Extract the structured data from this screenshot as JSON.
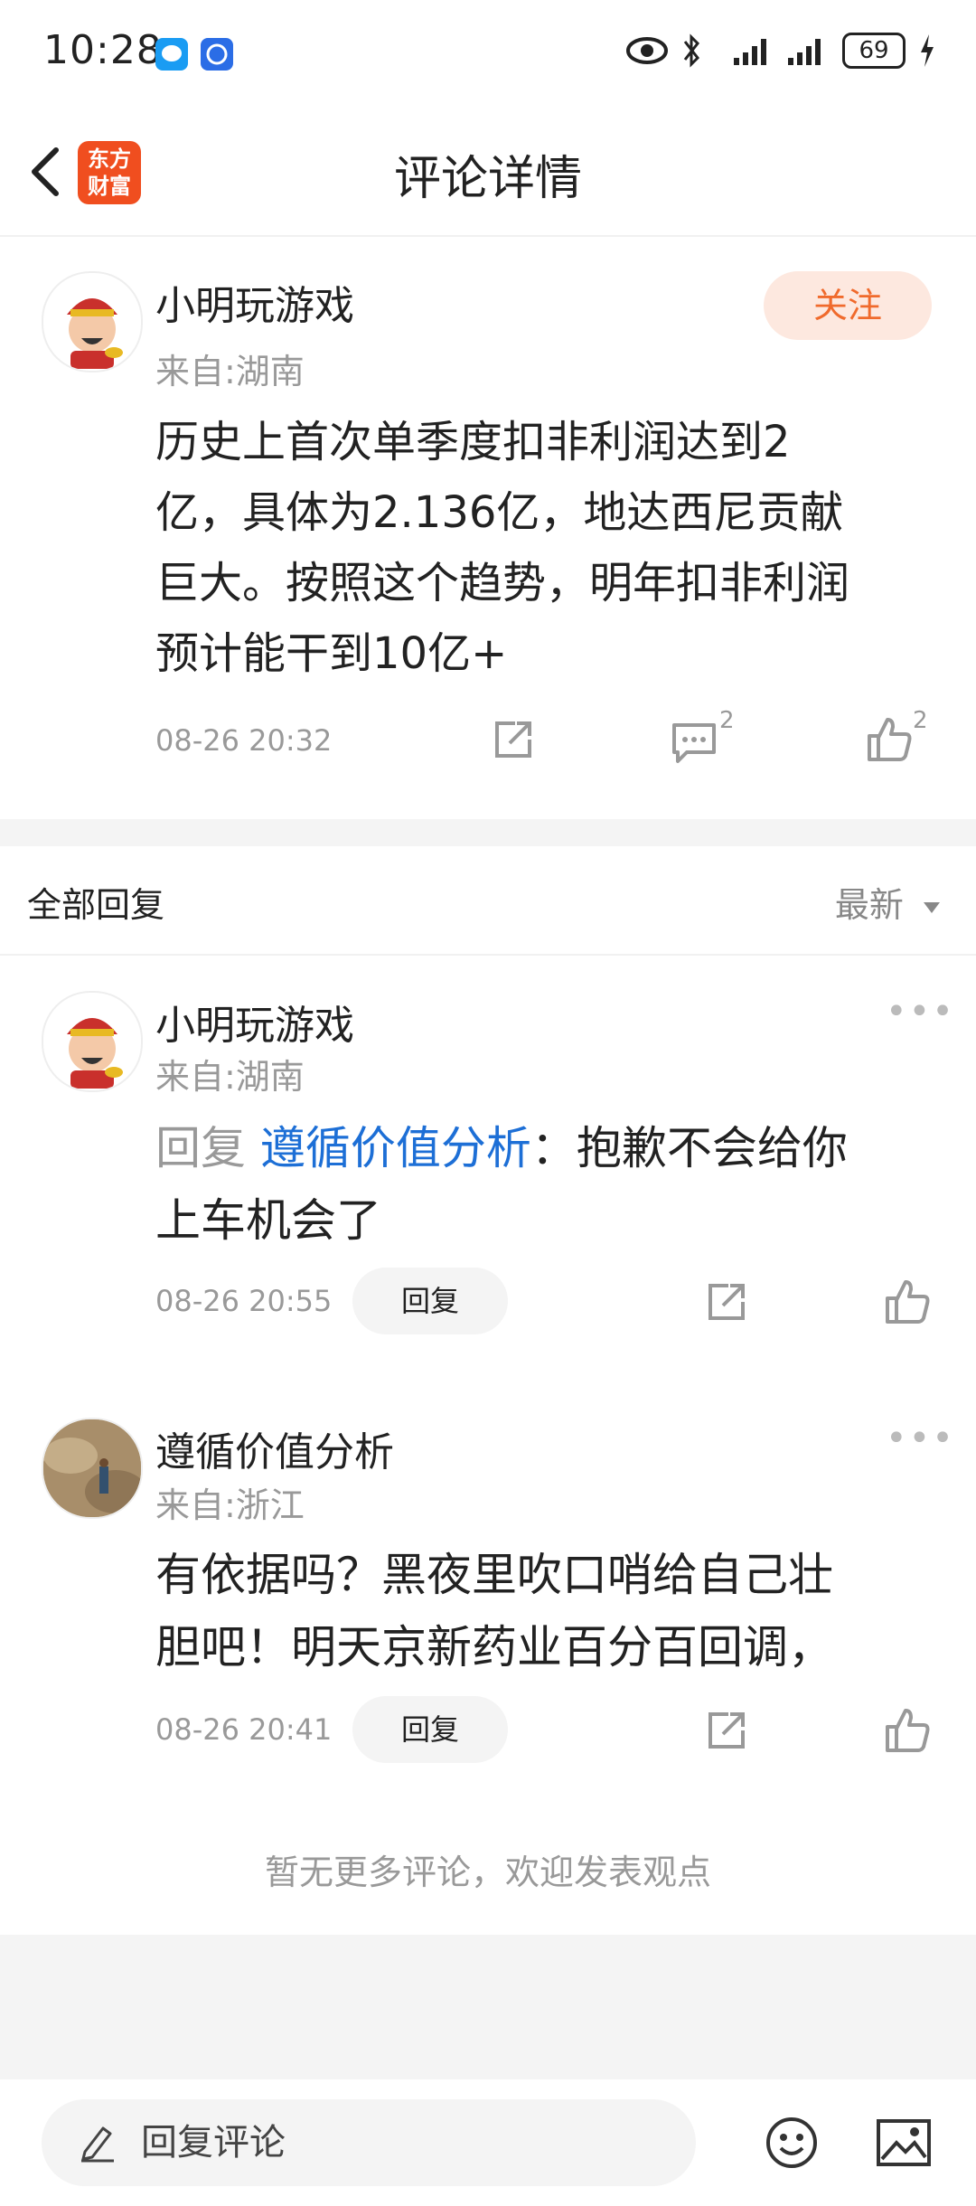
{
  "status_bar": {
    "time": "10:28",
    "battery": "69",
    "icons": [
      "message-app-icon",
      "app-icon",
      "eye-icon",
      "bluetooth-icon",
      "signal-icon",
      "signal-icon",
      "charging-icon"
    ]
  },
  "header": {
    "logo_line1": "东方",
    "logo_line2": "财富",
    "title": "评论详情"
  },
  "post": {
    "username": "小明玩游戏",
    "location": "来自:湖南",
    "follow_label": "关注",
    "content_lines": [
      "历史上首次单季度扣非利润达到2",
      "亿，具体为2.136亿，地达西尼贡献",
      "巨大。按照这个趋势，明年扣非利润",
      "预计能干到10亿+"
    ],
    "time": "08-26 20:32",
    "comment_count": "2",
    "like_count": "2"
  },
  "replies_section": {
    "title": "全部回复",
    "sort_label": "最新",
    "replies": [
      {
        "username": "小明玩游戏",
        "location": "来自:湖南",
        "reply_prefix": "回复",
        "reply_target": "遵循价值分析",
        "line1_rest": "：抱歉不会给你",
        "line2": "上车机会了",
        "time": "08-26 20:55",
        "reply_label": "回复"
      },
      {
        "username": "遵循价值分析",
        "location": "来自:浙江",
        "line1": "有依据吗？黑夜里吹口哨给自己壮",
        "line2": "胆吧！明天京新药业百分百回调，",
        "time": "08-26 20:41",
        "reply_label": "回复"
      }
    ],
    "no_more": "暂无更多评论，欢迎发表观点"
  },
  "bottom_bar": {
    "input_placeholder": "回复评论"
  },
  "colors": {
    "accent": "#f06a2c",
    "link": "#1d6fd6",
    "logo": "#f04e1f"
  }
}
